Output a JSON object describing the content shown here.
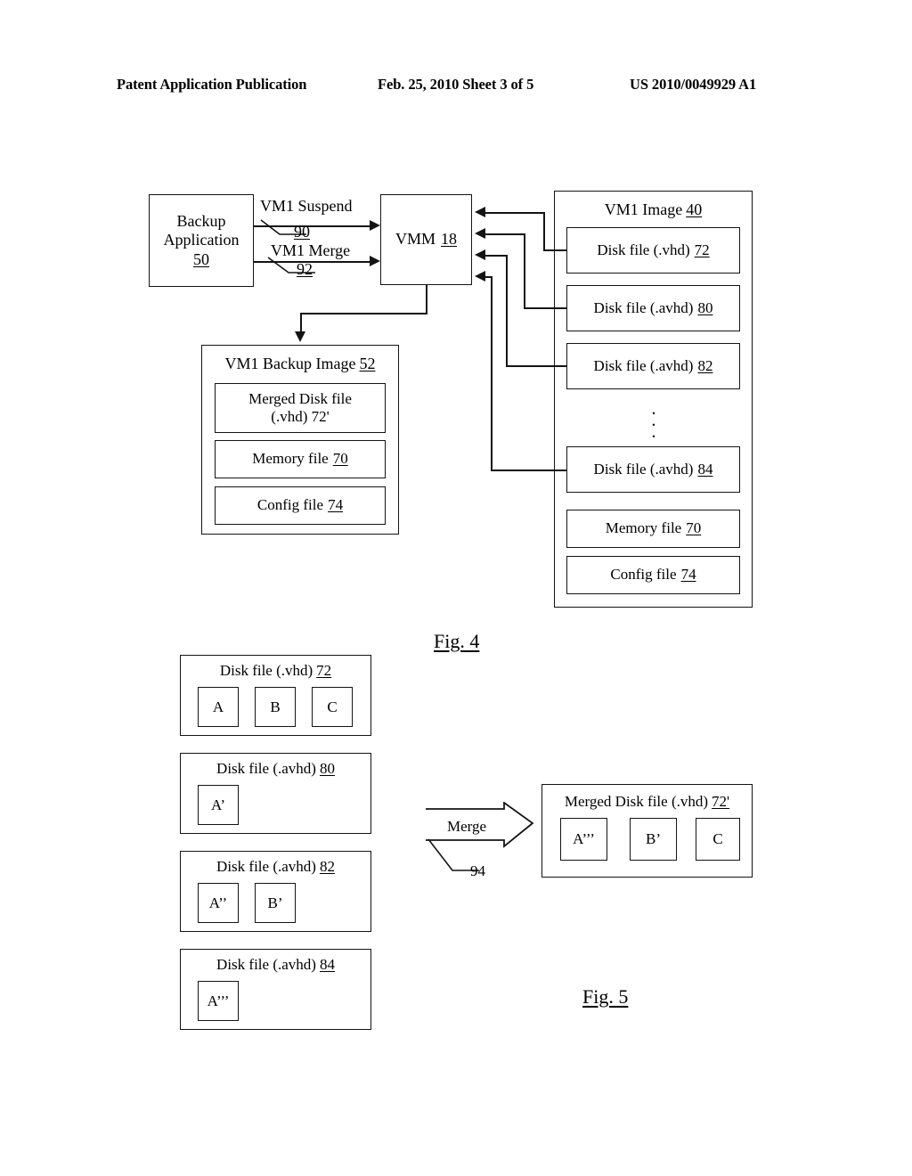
{
  "header": {
    "publication": "Patent Application Publication",
    "date_sheet": "Feb. 25, 2010  Sheet 3 of 5",
    "patent_number": "US 2010/0049929 A1"
  },
  "fig4": {
    "caption": "Fig. 4",
    "backup_application": {
      "line1": "Backup",
      "line2": "Application",
      "ref": "50"
    },
    "vmm": {
      "label": "VMM",
      "ref": "18"
    },
    "signals": [
      {
        "label": "VM1 Suspend",
        "ref": "90"
      },
      {
        "label": "VM1 Merge",
        "ref": "92"
      }
    ],
    "backup_image": {
      "title": "VM1 Backup Image",
      "ref": "52",
      "items": [
        {
          "line1": "Merged Disk file",
          "line2": "(.vhd) 72'",
          "ref": "72'"
        },
        {
          "line1": "Memory file",
          "ref": "70"
        },
        {
          "line1": "Config file",
          "ref": "74"
        }
      ]
    },
    "vm1_image": {
      "title": "VM1 Image",
      "ref": "40",
      "items": [
        {
          "label": "Disk file (.vhd)",
          "ref": "72"
        },
        {
          "label": "Disk file (.avhd)",
          "ref": "80"
        },
        {
          "label": "Disk file (.avhd)",
          "ref": "82"
        },
        {
          "label": "Disk file (.avhd)",
          "ref": "84"
        },
        {
          "label": "Memory file",
          "ref": "70"
        },
        {
          "label": "Config file",
          "ref": "74"
        }
      ],
      "ellipsis": "⋮"
    }
  },
  "fig5": {
    "caption": "Fig. 5",
    "sources": [
      {
        "title": "Disk file (.vhd)",
        "ref": "72",
        "blocks": [
          "A",
          "B",
          "C"
        ]
      },
      {
        "title": "Disk file (.avhd)",
        "ref": "80",
        "blocks": [
          "A’"
        ]
      },
      {
        "title": "Disk file (.avhd)",
        "ref": "82",
        "blocks": [
          "A’’",
          "B’"
        ]
      },
      {
        "title": "Disk file (.avhd)",
        "ref": "84",
        "blocks": [
          "A’’’"
        ]
      }
    ],
    "merge": {
      "label": "Merge",
      "ref": "94"
    },
    "result": {
      "title": "Merged Disk file (.vhd)",
      "ref": "72'",
      "blocks": [
        "A’’’",
        "B’",
        "C"
      ]
    }
  }
}
